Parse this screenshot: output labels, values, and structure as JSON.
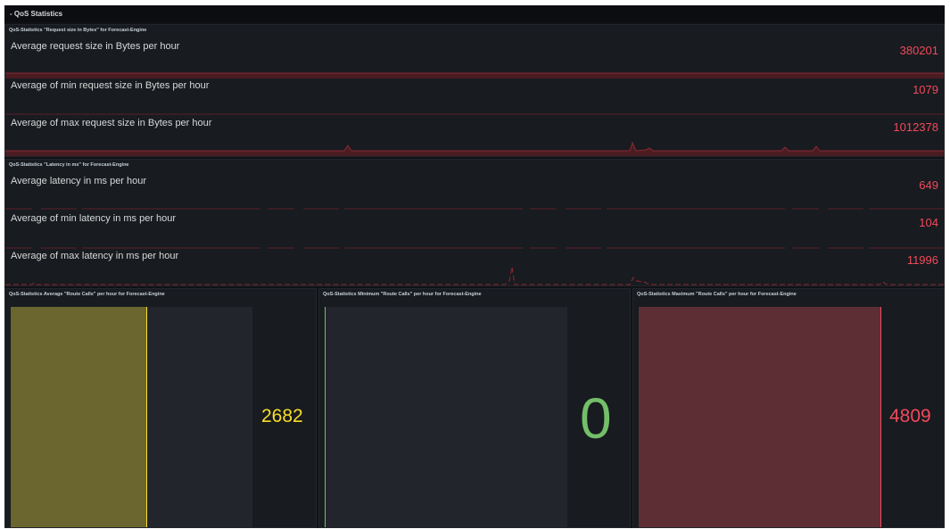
{
  "row_title": "- QoS Statistics",
  "colors": {
    "red": "#f2495c",
    "yellow": "#fade2a",
    "green": "#73bf69",
    "bar_yellow": "#6b6530",
    "bar_red": "#5d2f34"
  },
  "request_size_panel": {
    "title": "QoS-Statistics \"Request size in Bytes\" for Forecast-Engine",
    "stats": [
      {
        "label": "Average request size in Bytes per hour",
        "value": "380201"
      },
      {
        "label": "Average of min request size in Bytes per hour",
        "value": "1079"
      },
      {
        "label": "Average of max request size in Bytes per hour",
        "value": "1012378"
      }
    ]
  },
  "latency_panel": {
    "title": "QoS-Statistics \"Latency in ms\" for Forecast-Engine",
    "stats": [
      {
        "label": "Average latency in ms per hour",
        "value": "649"
      },
      {
        "label": "Average of min latency in ms per hour",
        "value": "104"
      },
      {
        "label": "Average of max latency in ms per hour",
        "value": "11996"
      }
    ]
  },
  "route_panels": [
    {
      "title": "QoS-Statistics Average \"Route Calls\" per hour for Forecast-Engine",
      "value": "2682",
      "fill_fraction": 0.56
    },
    {
      "title": "QoS-Statistics Minimum \"Route Calls\" per hour for Forecast-Engine",
      "value": "0",
      "fill_fraction": 0.0
    },
    {
      "title": "QoS-Statistics Maximum \"Route Calls\" per hour for Forecast-Engine",
      "value": "4809",
      "fill_fraction": 1.0
    }
  ]
}
